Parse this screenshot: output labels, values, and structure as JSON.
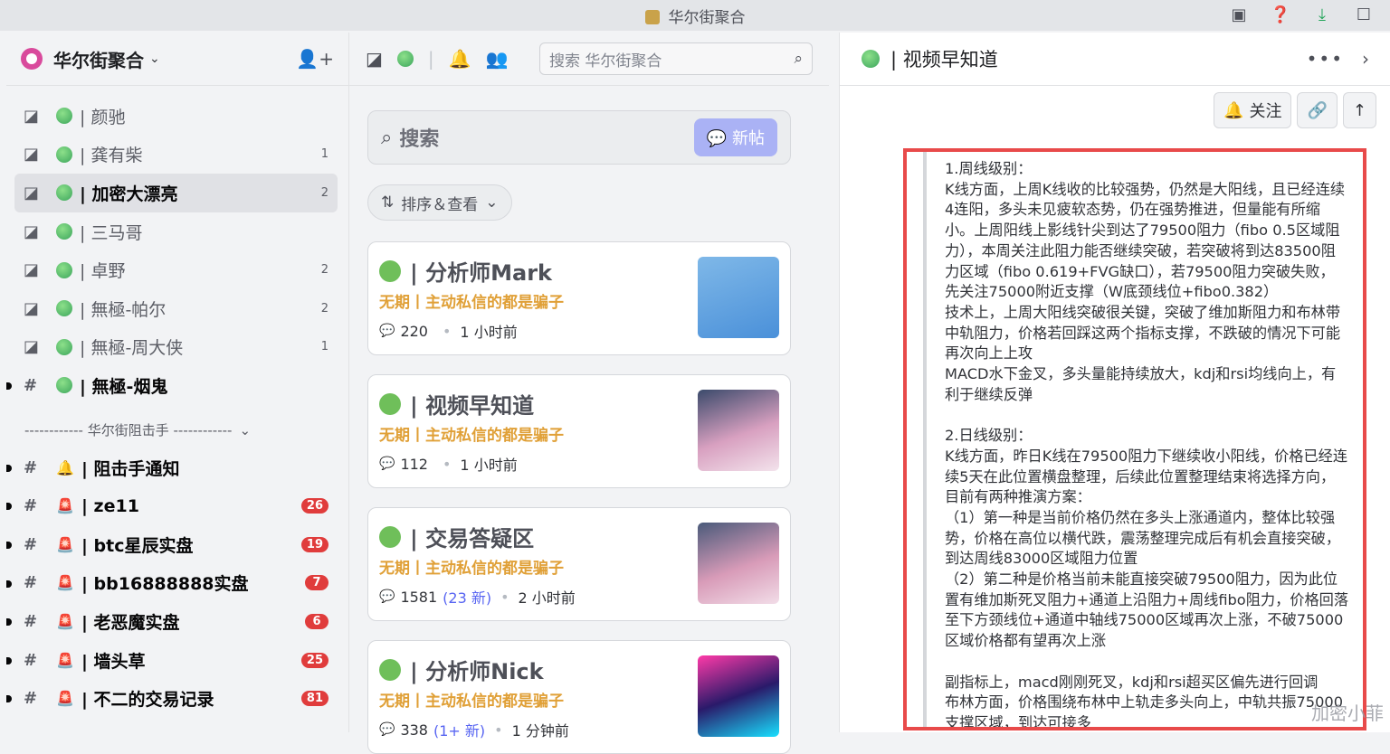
{
  "window": {
    "title": "华尔街聚合"
  },
  "titlebar_icons": [
    "inbox-icon",
    "help-icon",
    "download-icon",
    "maximize-icon"
  ],
  "sidebar": {
    "server_name": "华尔街聚合",
    "channels": [
      {
        "name": "| 颜驰",
        "type": "forum",
        "count": ""
      },
      {
        "name": "| 龚有柴",
        "type": "forum",
        "count": "1"
      },
      {
        "name": "| 加密大漂亮",
        "type": "forum",
        "count": "2",
        "selected": true
      },
      {
        "name": "| 三马哥",
        "type": "forum",
        "count": ""
      },
      {
        "name": "| 卓野",
        "type": "forum",
        "count": "2"
      },
      {
        "name": "| 無極-帕尔",
        "type": "forum",
        "count": "2"
      },
      {
        "name": "| 無極-周大侠",
        "type": "forum",
        "count": "1"
      },
      {
        "name": "| 無極-烟鬼",
        "type": "text",
        "count": "",
        "unread": true
      }
    ],
    "category": "------------ 华尔街阻击手 ------------",
    "category_channels": [
      {
        "name": "| 阻击手通知",
        "emoji": "🔔",
        "badge": ""
      },
      {
        "name": "| ze11",
        "emoji": "🚨",
        "badge": "26"
      },
      {
        "name": "| btc星辰实盘",
        "emoji": "🚨",
        "badge": "19"
      },
      {
        "name": "| bb16888888实盘",
        "emoji": "🚨",
        "badge": "7"
      },
      {
        "name": "| 老恶魔实盘",
        "emoji": "🚨",
        "badge": "6"
      },
      {
        "name": "| 墙头草",
        "emoji": "🚨",
        "badge": "25"
      },
      {
        "name": "| 不二的交易记录",
        "emoji": "🚨",
        "badge": "81"
      }
    ]
  },
  "middle": {
    "search_placeholder": "搜索 华尔街聚合",
    "forum_search_label": "搜索",
    "new_post_label": "新帖",
    "sort_label": "排序＆查看",
    "cards": [
      {
        "title": "| 分析师Mark",
        "subtitle": "无期丨主动私信的都是骗子",
        "comments": "220",
        "new": "",
        "time": "1 小时前"
      },
      {
        "title": "| 视频早知道",
        "subtitle": "无期丨主动私信的都是骗子",
        "comments": "112",
        "new": "",
        "time": "1 小时前"
      },
      {
        "title": "| 交易答疑区",
        "subtitle": "无期丨主动私信的都是骗子",
        "comments": "1581",
        "new": "(23 新)",
        "time": "2 小时前"
      },
      {
        "title": "| 分析师Nick",
        "subtitle": "无期丨主动私信的都是骗子",
        "comments": "338",
        "new": "(1+ 新)",
        "time": "1 分钟前"
      }
    ]
  },
  "right": {
    "title": "| 视频早知道",
    "follow_label": "关注",
    "post_text": "1.周线级别：\nK线方面，上周K线收的比较强势，仍然是大阳线，且已经连续4连阳，多头未见疲软态势，仍在强势推进，但量能有所缩小。上周阳线上影线针尖到达了79500阻力（fibo 0.5区域阻力），本周关注此阻力能否继续突破，若突破将到达83500阻力区域（fibo 0.619+FVG缺口），若79500阻力突破失败，先关注75000附近支撑（W底颈线位+fibo0.382）\n技术上，上周大阳线突破很关键，突破了维加斯阻力和布林带中轨阻力，价格若回踩这两个指标支撑，不跌破的情况下可能再次向上上攻\nMACD水下金叉，多头量能持续放大，kdj和rsi均线向上，有利于继续反弹\n\n2.日线级别：\nK线方面，昨日K线在79500阻力下继续收小阳线，价格已经连续5天在此位置横盘整理，后续此位置整理结束将选择方向，目前有两种推演方案：\n（1）第一种是当前价格仍然在多头上涨通道内，整体比较强势，价格在高位以横代跌，震荡整理完成后有机会直接突破，到达周线83000区域阻力位置\n（2）第二种是价格当前未能直接突破79500阻力，因为此位置有维加斯死叉阻力+通道上沿阻力+周线fibo阻力，价格回落至下方颈线位+通道中轴线75000区域再次上涨，不破75000区域价格都有望再次上涨\n\n副指标上，macd刚刚死叉，kdj和rsi超买区偏先进行回调\n布林方面，价格围绕布林中上轨走多头向上，中轨共振75000支撑区域，到达可接多",
    "watermark": "加密小菲"
  },
  "colors": {
    "accent": "#5865f2",
    "badge": "#e03c3c",
    "highlight_box": "#e84a4a",
    "subtitle": "#e0a037"
  }
}
